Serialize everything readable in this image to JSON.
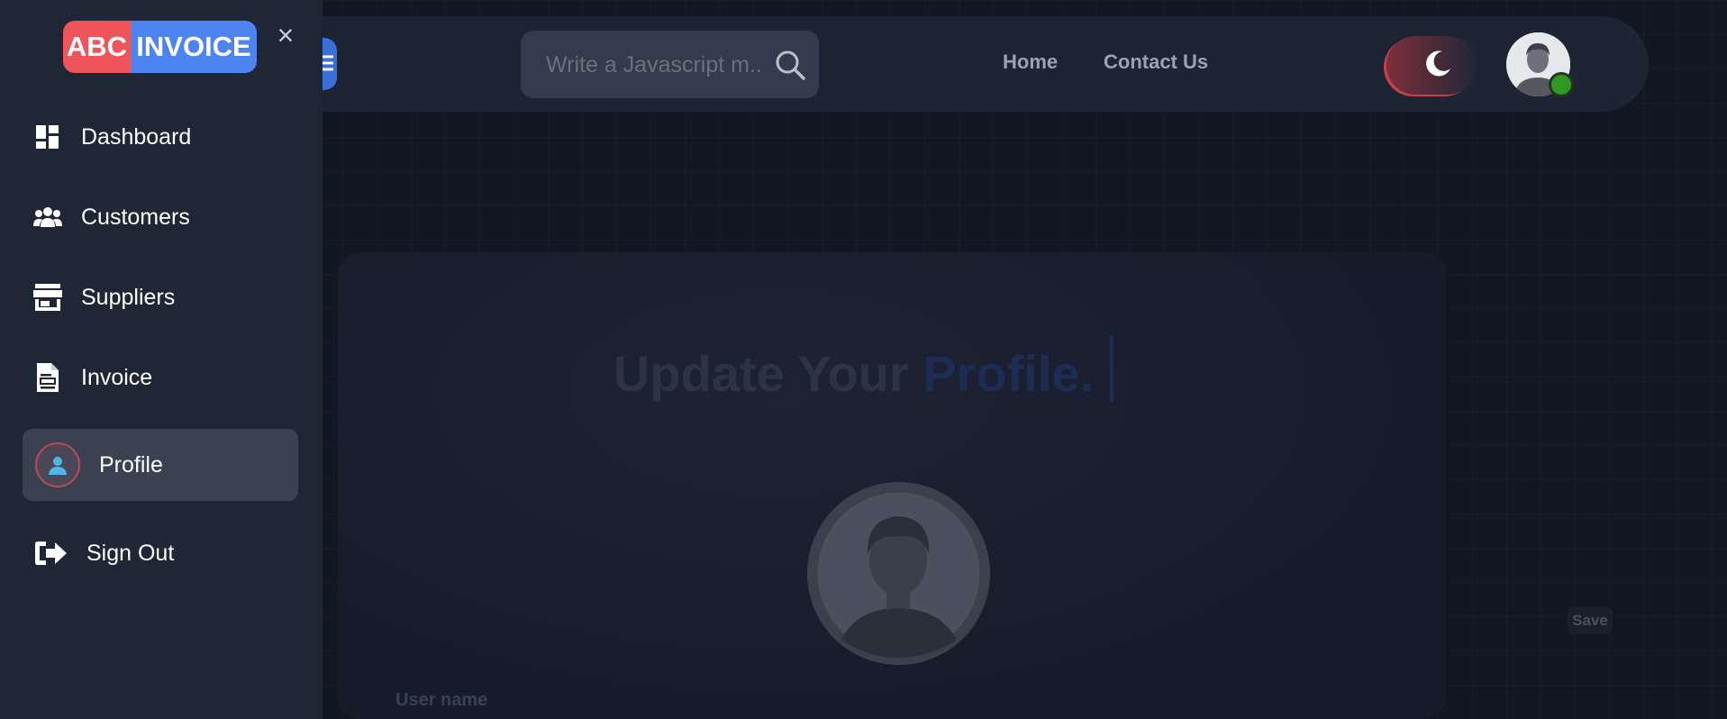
{
  "app": {
    "logo_part1": "ABC",
    "logo_part2": "INVOICE",
    "close_glyph": "×"
  },
  "sidebar": {
    "items": [
      {
        "label": "Dashboard",
        "icon": "dashboard-icon"
      },
      {
        "label": "Customers",
        "icon": "users-icon"
      },
      {
        "label": "Suppliers",
        "icon": "store-icon"
      },
      {
        "label": "Invoice",
        "icon": "invoice-icon"
      },
      {
        "label": "Profile",
        "icon": "profile-icon",
        "active": true
      },
      {
        "label": "Sign Out",
        "icon": "sign-out-icon"
      }
    ]
  },
  "header": {
    "menu_glyph": "☰",
    "search_placeholder": "Write a Javascript m...",
    "links": [
      "Home",
      "Contact Us"
    ],
    "theme": "dark"
  },
  "main": {
    "title_plain": "Update Your",
    "title_accent": "Profile.",
    "save_label": "Save",
    "username_label": "User name"
  },
  "colors": {
    "logo_red": "#f0555c",
    "logo_blue": "#4d84f0",
    "sidebar_bg": "#1f2636",
    "page_bg": "#121724",
    "online": "#2e9a22"
  }
}
